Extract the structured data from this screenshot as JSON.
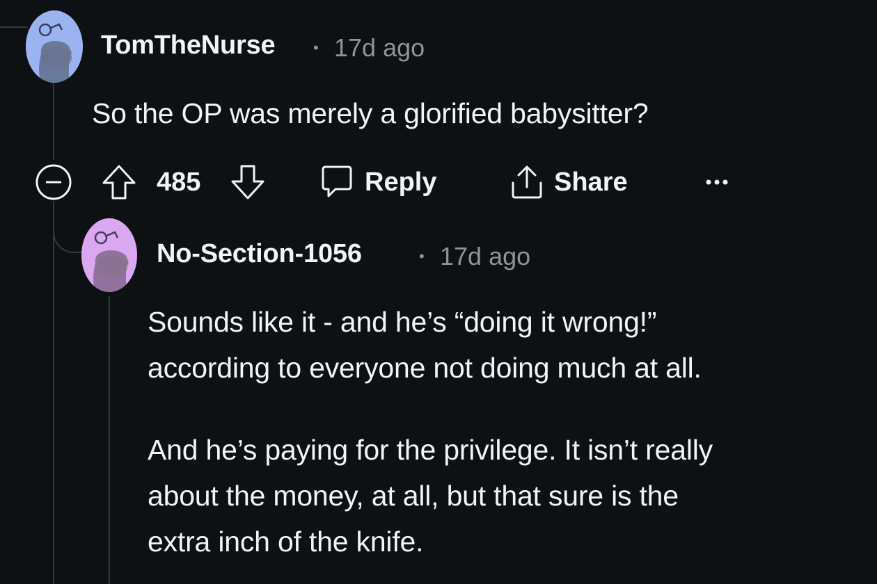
{
  "comments": [
    {
      "username": "TomTheNurse",
      "separator": "•",
      "timestamp": "17d ago",
      "avatar_color": "#9bb3f0",
      "body": [
        "So the OP was merely a glorified babysitter?"
      ],
      "actions": {
        "collapse_icon": "collapse-minus-icon",
        "upvote_icon": "upvote-arrow-icon",
        "score": "485",
        "downvote_icon": "downvote-arrow-icon",
        "reply_label": "Reply",
        "share_label": "Share",
        "more_icon": "more-dots-icon"
      }
    },
    {
      "username": "No-Section-1056",
      "separator": "•",
      "timestamp": "17d ago",
      "avatar_color": "#d9a8f0",
      "body": [
        "Sounds like it - and he’s “doing it wrong!”",
        "according to everyone not doing much at all.",
        "And he’s paying for the privilege. It isn’t really",
        "about the money, at all, but that sure is the",
        "extra inch of the knife."
      ]
    }
  ],
  "colors": {
    "background": "#0e1113",
    "text": "#f2f4f5",
    "muted": "#8b959b",
    "thread_line": "#33393e"
  }
}
